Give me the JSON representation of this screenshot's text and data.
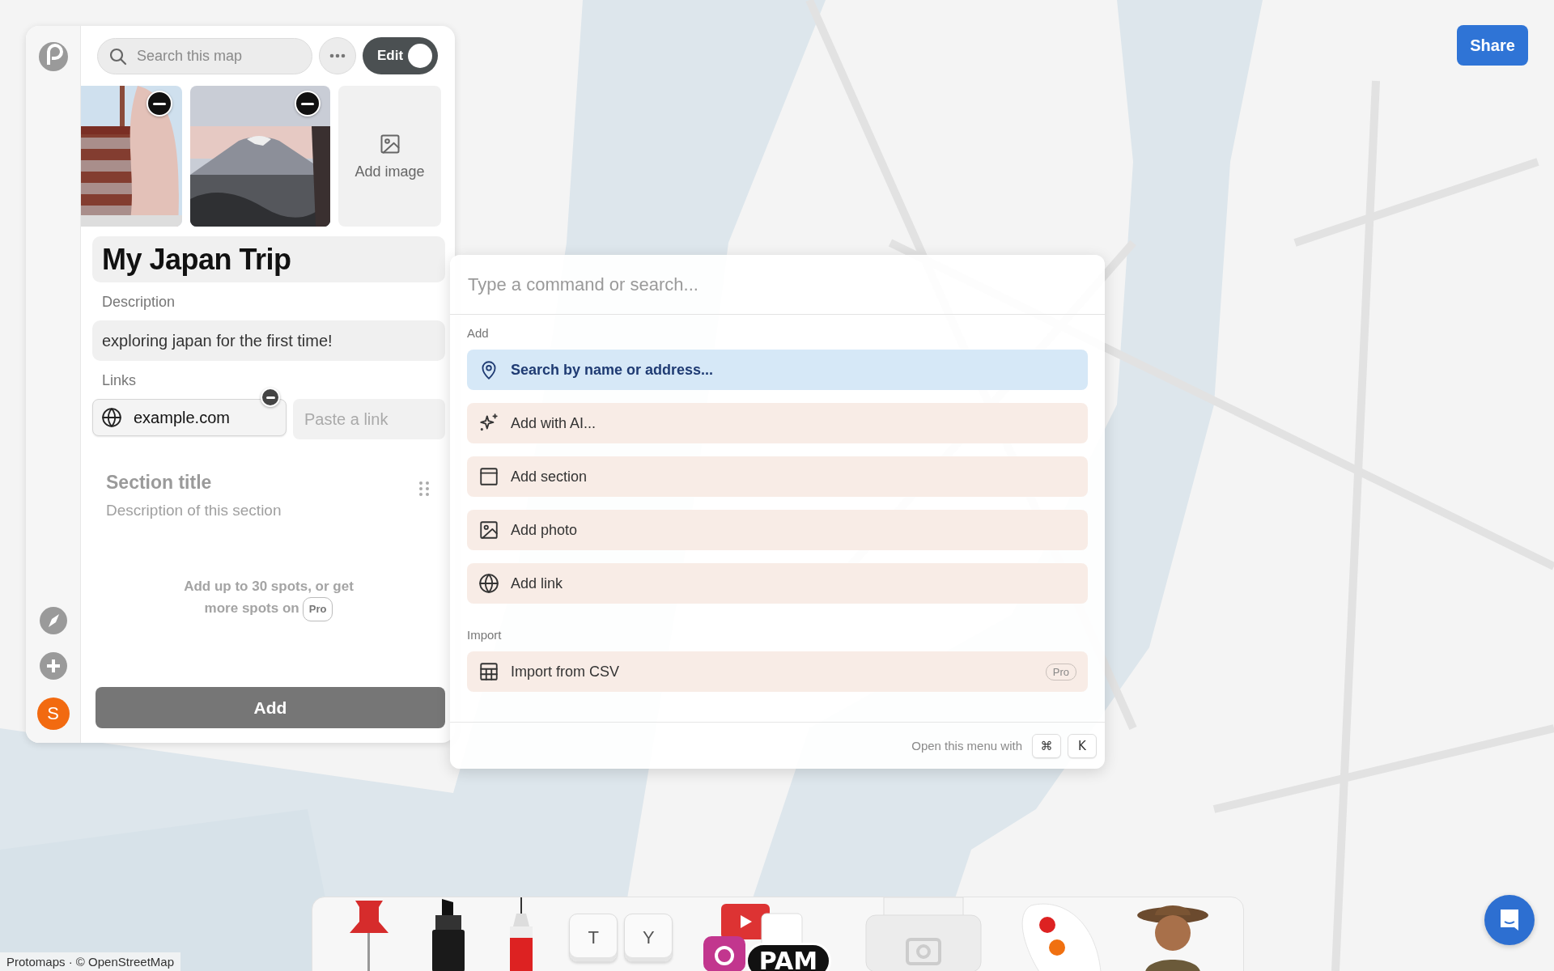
{
  "sidebar": {
    "avatar_initial": "S"
  },
  "search": {
    "placeholder": "Search this map"
  },
  "edit_toggle": {
    "label": "Edit",
    "on": true
  },
  "add_image": "Add image",
  "title": "My Japan Trip",
  "description": {
    "label": "Description",
    "value": "exploring japan for the first time!"
  },
  "links": {
    "label": "Links",
    "items": [
      {
        "value": "example.com"
      }
    ],
    "placeholder": "Paste a link"
  },
  "section": {
    "title_placeholder": "Section title",
    "description_placeholder": "Description of this section"
  },
  "spots_note": {
    "text": "Add up to 30 spots, or get more spots on",
    "badge": "Pro"
  },
  "add_button": "Add",
  "command_palette": {
    "placeholder": "Type a command or search...",
    "groups": [
      {
        "heading": "Add",
        "items": [
          {
            "label": "Search by name or address...",
            "selected": true
          },
          {
            "label": "Add with AI...",
            "selected": false
          },
          {
            "label": "Add section",
            "selected": false
          },
          {
            "label": "Add photo",
            "selected": false
          },
          {
            "label": "Add link",
            "selected": false
          }
        ]
      },
      {
        "heading": "Import",
        "items": [
          {
            "label": "Import from CSV",
            "selected": false,
            "badge": "Pro"
          }
        ]
      }
    ],
    "footer": {
      "text": "Open this menu with",
      "keys": [
        "⌘",
        "K"
      ]
    }
  },
  "share_button": "Share",
  "attribution": "Protomaps · © OpenStreetMap",
  "dock": [
    {
      "kind": "pushpin"
    },
    {
      "kind": "marker"
    },
    {
      "kind": "pen"
    },
    {
      "kind": "keys",
      "keys": [
        "T",
        "Y"
      ]
    },
    {
      "kind": "stickers",
      "sticker": "PAM"
    },
    {
      "kind": "camera"
    },
    {
      "kind": "palette"
    },
    {
      "kind": "figure"
    }
  ]
}
